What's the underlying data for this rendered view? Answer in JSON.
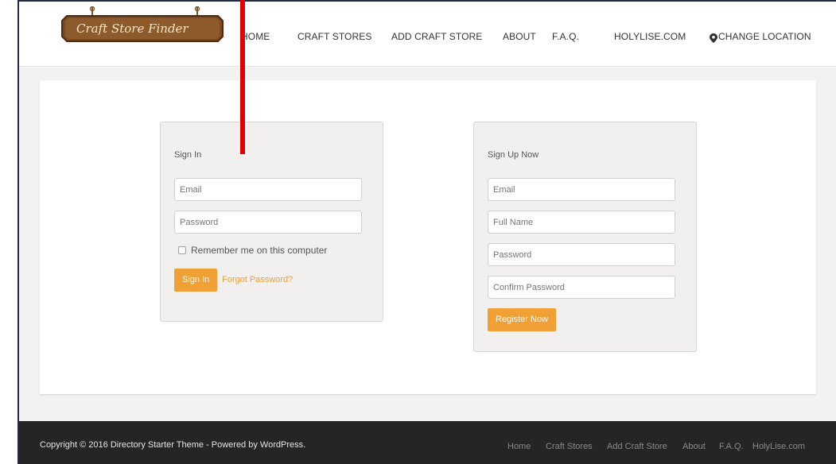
{
  "logo": {
    "text": "Craft Store Finder"
  },
  "nav": {
    "items": [
      "HOME",
      "CRAFT STORES",
      "ADD CRAFT STORE",
      "ABOUT",
      "F.A.Q.",
      "HOLYLISE.COM",
      "CHANGE LOCATION"
    ]
  },
  "signin": {
    "title": "Sign In",
    "email_placeholder": "Email",
    "password_placeholder": "Password",
    "remember_label": "Remember me on this computer",
    "button": "Sign In",
    "forgot": "Forgot Password?"
  },
  "signup": {
    "title": "Sign Up Now",
    "email_placeholder": "Email",
    "name_placeholder": "Full Name",
    "password_placeholder": "Password",
    "confirm_placeholder": "Confirm Password",
    "button": "Register Now"
  },
  "footer": {
    "copyright": "Copyright © 2016 Directory Starter Theme - Powered by WordPress.",
    "links": [
      "Home",
      "Craft Stores",
      "Add Craft Store",
      "About",
      "F.A.Q.",
      "HolyLise.com"
    ]
  },
  "colors": {
    "accent": "#f0a035",
    "footer_bg": "#252525",
    "annotation": "#e00000"
  }
}
